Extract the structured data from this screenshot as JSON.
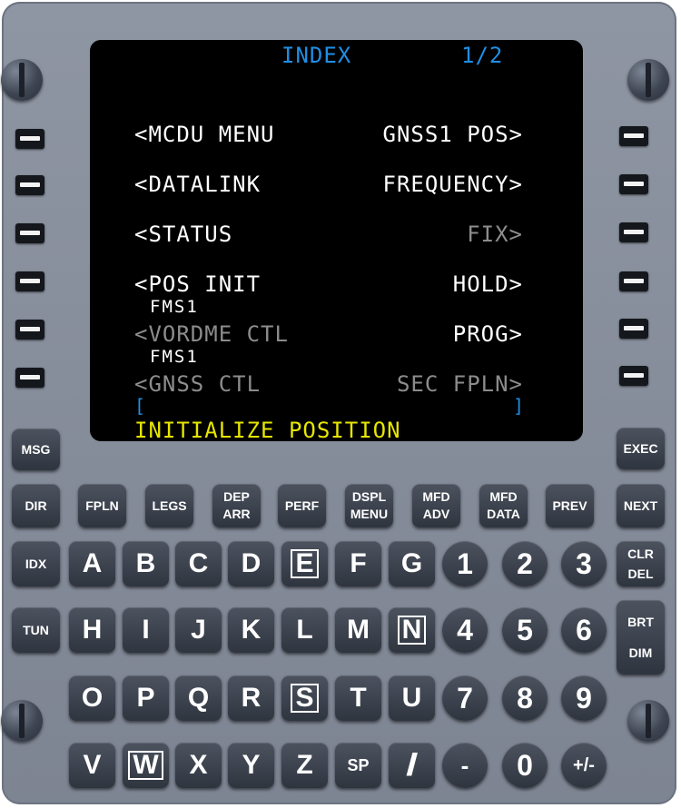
{
  "screen": {
    "title": "INDEX",
    "page": "1/2",
    "left": [
      {
        "label": "<MCDU MENU",
        "sub": "",
        "state": "active"
      },
      {
        "label": "<DATALINK",
        "sub": "",
        "state": "active"
      },
      {
        "label": "<STATUS",
        "sub": "",
        "state": "active"
      },
      {
        "label": "<POS INIT",
        "sub": "FMS1",
        "state": "active"
      },
      {
        "label": "<VORDME CTL",
        "sub": "FMS1",
        "state": "inactive"
      },
      {
        "label": "<GNSS CTL",
        "sub": "",
        "state": "inactive"
      }
    ],
    "right": [
      {
        "label": "GNSS1 POS>",
        "state": "active"
      },
      {
        "label": "FREQUENCY>",
        "state": "active"
      },
      {
        "label": "FIX>",
        "state": "inactive"
      },
      {
        "label": "HOLD>",
        "state": "active"
      },
      {
        "label": "PROG>",
        "state": "active"
      },
      {
        "label": "SEC FPLN>",
        "state": "inactive"
      }
    ],
    "scratchpad_left_bracket": "[",
    "scratchpad_right_bracket": "]",
    "message": "INITIALIZE POSITION",
    "colors": {
      "title": "#1e8fe6",
      "active": "#ffffff",
      "inactive": "#8c8c8c",
      "message": "#e6e600",
      "bracket": "#1e8fe6"
    }
  },
  "keys": {
    "msg": "MSG",
    "exec": "EXEC",
    "function_row": [
      "DIR",
      "FPLN",
      "LEGS",
      "DEP\nARR",
      "PERF",
      "DSPL\nMENU",
      "MFD\nADV",
      "MFD\nDATA",
      "PREV",
      "NEXT"
    ],
    "idx": "IDX",
    "tun": "TUN",
    "clr_del": "CLR\nDEL",
    "brt_dim": "BRT\n\nDIM",
    "alpha_row1": [
      "A",
      "B",
      "C",
      "D",
      "E",
      "F",
      "G"
    ],
    "alpha_row2": [
      "H",
      "I",
      "J",
      "K",
      "L",
      "M",
      "N"
    ],
    "alpha_row3": [
      "O",
      "P",
      "Q",
      "R",
      "S",
      "T",
      "U"
    ],
    "alpha_row4": [
      "V",
      "W",
      "X",
      "Y",
      "Z",
      "SP",
      "/"
    ],
    "numeric_row1": [
      "1",
      "2",
      "3"
    ],
    "numeric_row2": [
      "4",
      "5",
      "6"
    ],
    "numeric_row3": [
      "7",
      "8",
      "9"
    ],
    "numeric_row4": [
      "-",
      "0",
      "+/-"
    ]
  }
}
